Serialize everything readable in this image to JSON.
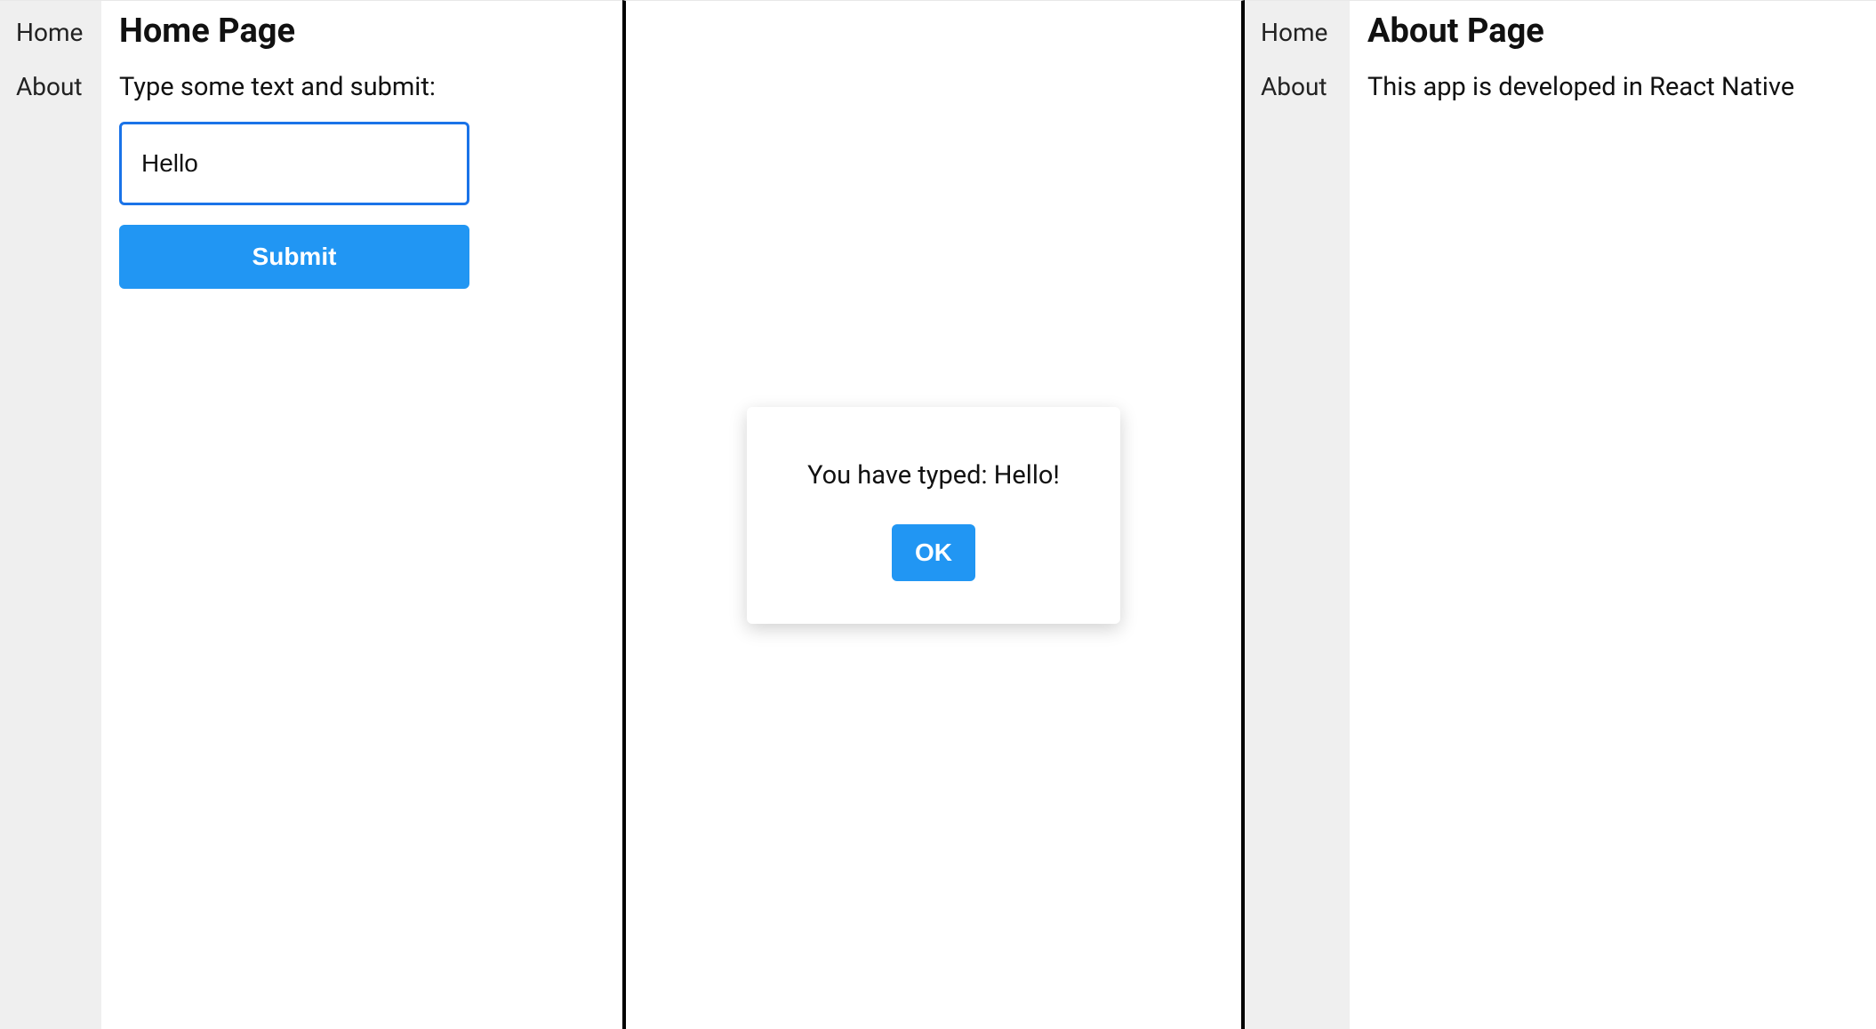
{
  "panel1": {
    "sidebar": {
      "items": [
        {
          "label": "Home"
        },
        {
          "label": "About"
        }
      ]
    },
    "title": "Home Page",
    "prompt": "Type some text and submit:",
    "input_value": "Hello",
    "submit_label": "Submit"
  },
  "panel2": {
    "dialog": {
      "message": "You have typed: Hello!",
      "ok_label": "OK"
    }
  },
  "panel3": {
    "sidebar": {
      "items": [
        {
          "label": "Home"
        },
        {
          "label": "About"
        }
      ]
    },
    "title": "About Page",
    "body": "This app is developed in React Native"
  }
}
